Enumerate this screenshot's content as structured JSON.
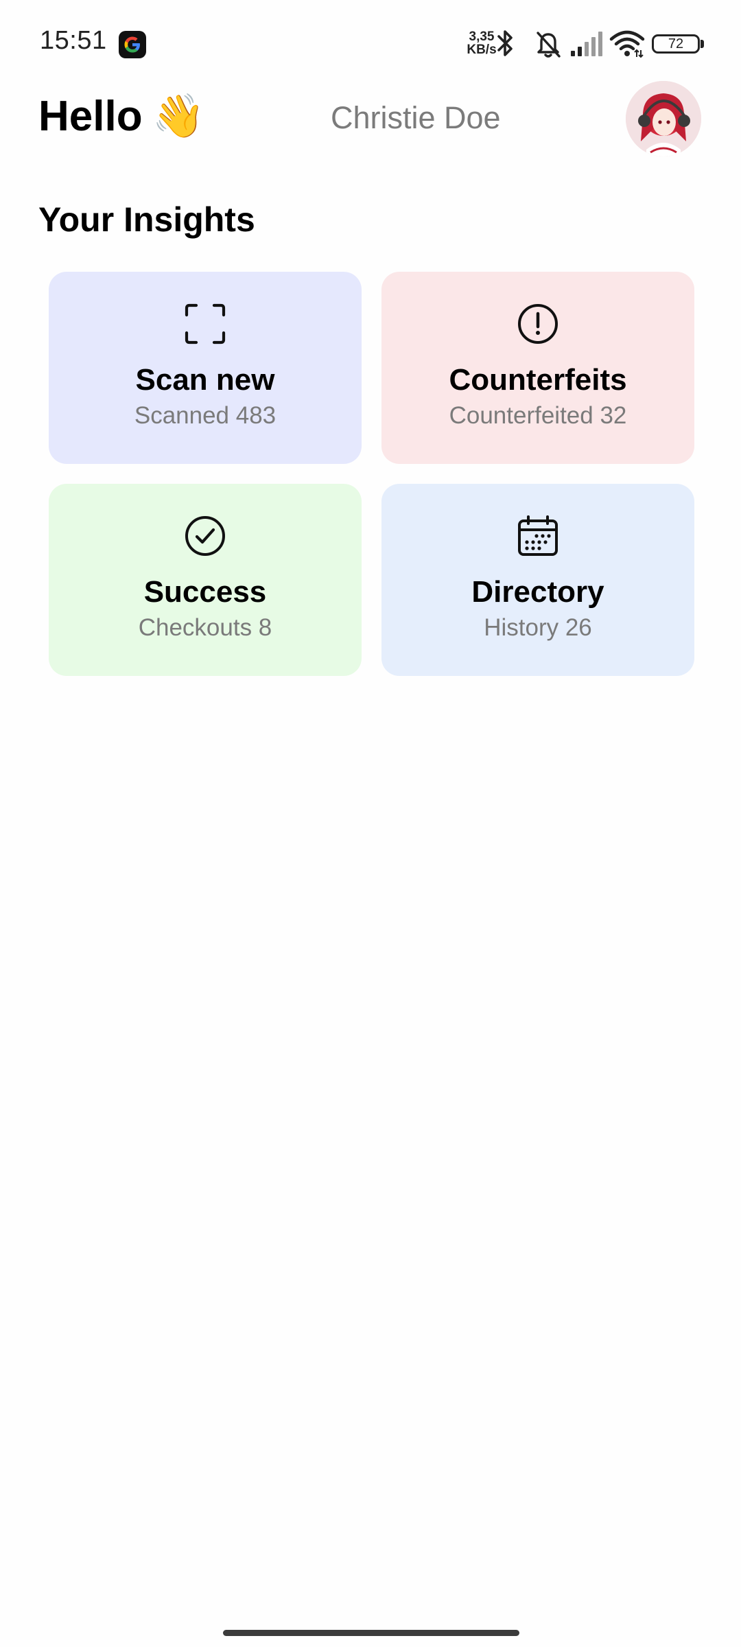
{
  "status_bar": {
    "time": "15:51",
    "net_speed_value": "3,35",
    "net_speed_unit": "KB/s",
    "battery": "72",
    "icons": [
      "google-icon",
      "bluetooth-icon",
      "bell-muted-icon",
      "signal-icon",
      "wifi-icon",
      "battery-icon"
    ]
  },
  "header": {
    "greeting": "Hello",
    "wave_emoji": "👋",
    "user_name": "Christie Doe"
  },
  "section_title": "Your Insights",
  "cards": [
    {
      "icon": "scan-icon",
      "title": "Scan new",
      "subtitle": "Scanned 483",
      "bg": "#e5e8fd"
    },
    {
      "icon": "alert-circle-icon",
      "title": "Counterfeits",
      "subtitle": "Counterfeited 32",
      "bg": "#fbe7e8"
    },
    {
      "icon": "check-circle-icon",
      "title": "Success",
      "subtitle": "Checkouts 8",
      "bg": "#e7fbe5"
    },
    {
      "icon": "calendar-icon",
      "title": "Directory",
      "subtitle": "History 26",
      "bg": "#e5eefc"
    }
  ]
}
